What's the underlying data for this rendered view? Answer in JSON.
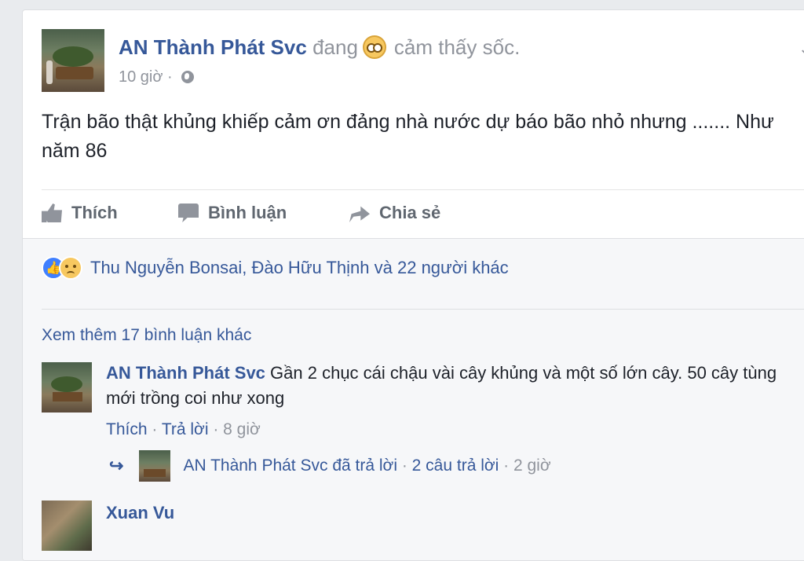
{
  "post": {
    "author": "AN Thành Phát Svc",
    "feeling_prefix": "đang",
    "feeling_text": "cảm thấy sốc.",
    "feeling_icon": "shocked-emoji-icon",
    "time": "10 giờ",
    "separator": "·",
    "privacy_icon": "globe-icon",
    "text": "Trận bão thật khủng khiếp cảm ơn đảng nhà nước dự báo bão nhỏ nhưng ....... Như năm 86"
  },
  "actions": {
    "like": "Thích",
    "comment": "Bình luận",
    "share": "Chia sẻ"
  },
  "reactions": {
    "icons": [
      "like-icon",
      "sad-icon"
    ],
    "text": "Thu Nguyễn Bonsai, Đào Hữu Thịnh và 22 người khác"
  },
  "comments": {
    "more": "Xem thêm 17 bình luận khác",
    "items": [
      {
        "author": "AN Thành Phát Svc",
        "text": "Gần 2 chục cái chậu vài cây khủng và một số lớn cây. 50 cây tùng mới trồng coi như xong",
        "like": "Thích",
        "reply": "Trả lời",
        "time": "8 giờ",
        "reply_summary": {
          "author": "AN Thành Phát Svc",
          "action": "đã trả lời",
          "count": "2 câu trả lời",
          "time": "2 giờ"
        }
      },
      {
        "author": "Xuan Vu"
      }
    ]
  },
  "colors": {
    "link": "#365899",
    "muted": "#90949c",
    "background": "#e9ebee",
    "like_blue": "#4080ff"
  }
}
